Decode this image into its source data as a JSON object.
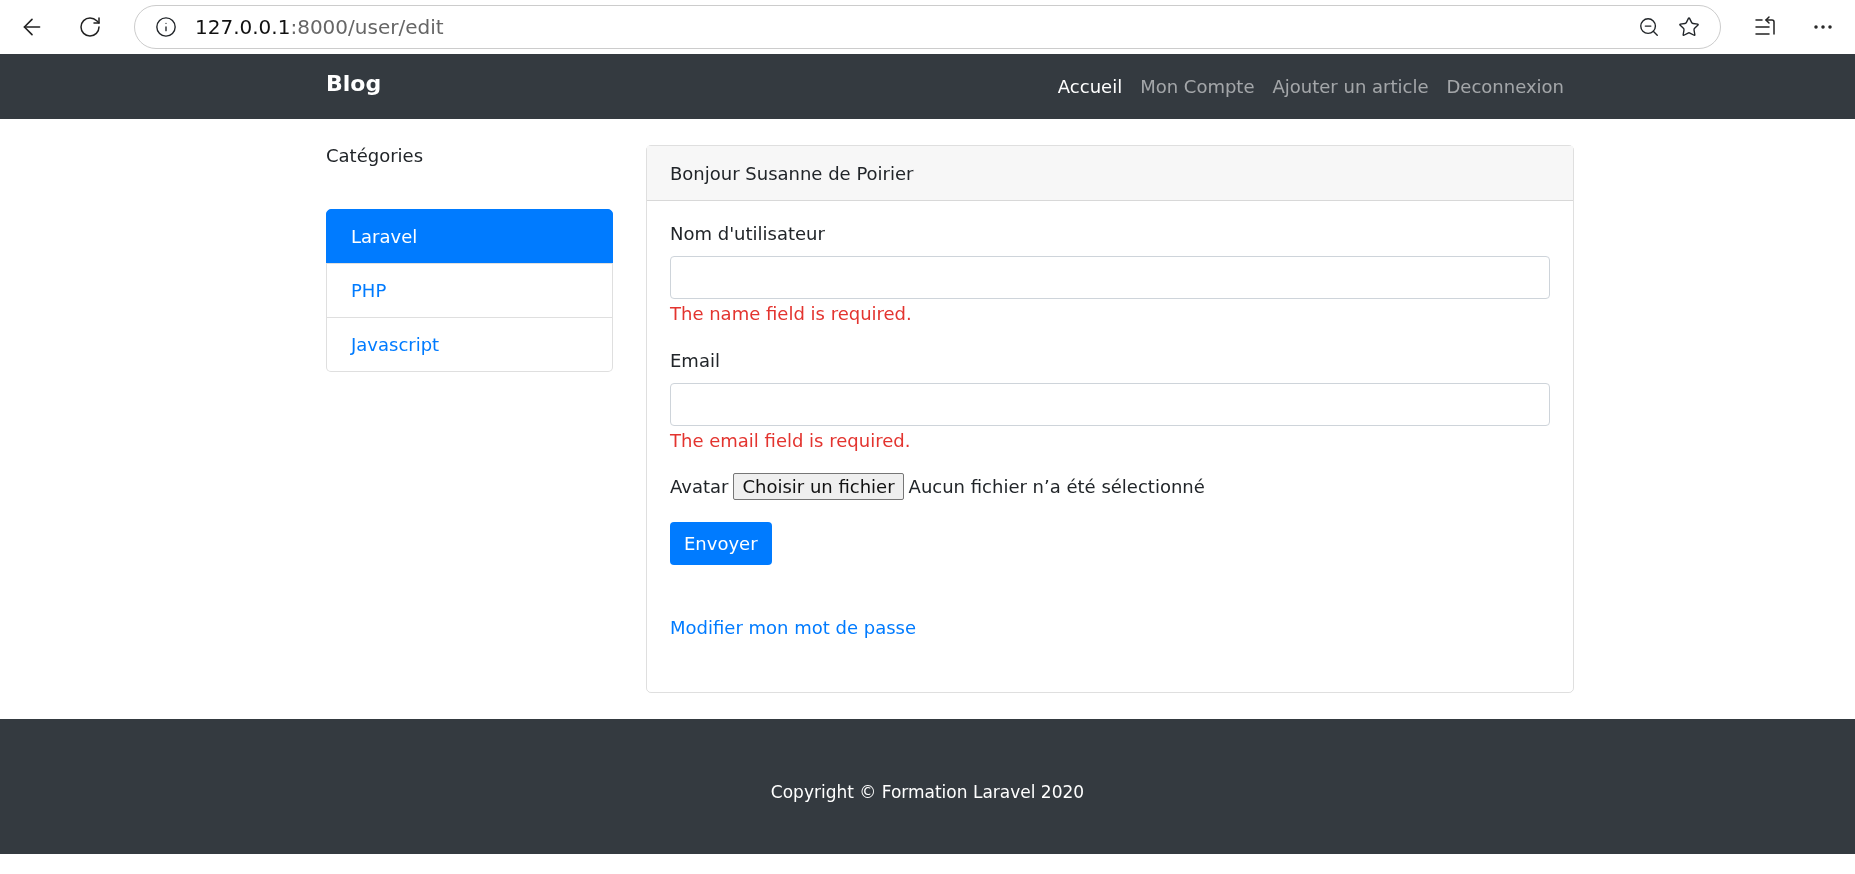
{
  "browser": {
    "address": {
      "host": "127.0.0.1",
      "path": ":8000/user/edit"
    }
  },
  "navbar": {
    "brand": "Blog",
    "links": [
      {
        "label": "Accueil",
        "selected": true
      },
      {
        "label": "Mon Compte",
        "selected": false
      },
      {
        "label": "Ajouter un article",
        "selected": false
      },
      {
        "label": "Deconnexion",
        "selected": false
      }
    ]
  },
  "sidebar": {
    "title": "Catégories",
    "items": [
      {
        "label": "Laravel",
        "selected": true
      },
      {
        "label": "PHP",
        "selected": false
      },
      {
        "label": "Javascript",
        "selected": false
      }
    ]
  },
  "card": {
    "header": "Bonjour Susanne de Poirier",
    "fields": [
      {
        "label": "Nom d'utilisateur",
        "error": "The name field is required."
      },
      {
        "label": "Email",
        "error": "The email field is required."
      }
    ],
    "file": {
      "label": "Avatar",
      "button": "Choisir un fichier",
      "status": "Aucun fichier n’a été sélectionné"
    },
    "submit": "Envoyer",
    "link": "Modifier mon mot de passe"
  },
  "footer": "Copyright © Formation Laravel 2020"
}
